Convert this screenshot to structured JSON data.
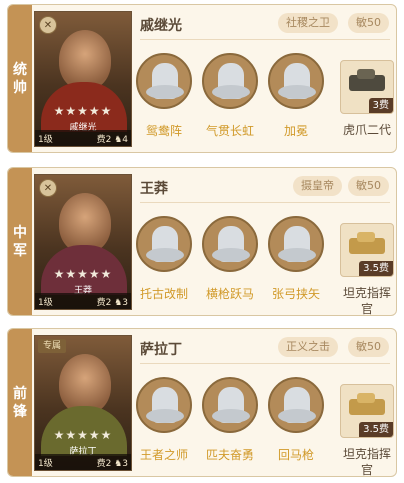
{
  "cards": [
    {
      "role": "统帅",
      "name": "戚继光",
      "faction": "社稷之卫",
      "stat": "敏50",
      "portrait_tag": "",
      "portrait_name": "戚继光",
      "stars": "★★★★★",
      "level": "1级",
      "cost": "费2",
      "count": "4",
      "skills": [
        "鸳鸯阵",
        "气贯长虹",
        "加冕"
      ],
      "tactic": {
        "name": "虎爪二代",
        "cost": "3费"
      }
    },
    {
      "role": "中军",
      "name": "王莽",
      "faction": "摄皇帝",
      "stat": "敏50",
      "portrait_tag": "",
      "portrait_name": "王莽",
      "stars": "★★★★★",
      "level": "1级",
      "cost": "费2",
      "count": "3",
      "skills": [
        "托古改制",
        "横枪跃马",
        "张弓挟矢"
      ],
      "tactic": {
        "name": "坦克指挥官",
        "cost": "3.5费"
      }
    },
    {
      "role": "前锋",
      "name": "萨拉丁",
      "faction": "正义之击",
      "stat": "敏50",
      "portrait_tag": "专属",
      "portrait_name": "萨拉丁",
      "stars": "★★★★★",
      "level": "1级",
      "cost": "费2",
      "count": "3",
      "skills": [
        "王者之师",
        "匹夫奋勇",
        "回马枪"
      ],
      "tactic": {
        "name": "坦克指挥官",
        "cost": "3.5费"
      }
    }
  ],
  "colors": {
    "card_bg": "#fcf6ea",
    "role_tab": "#c49355",
    "skill_label": "#d19a2a",
    "badge_bg": "#f2e2c8"
  }
}
